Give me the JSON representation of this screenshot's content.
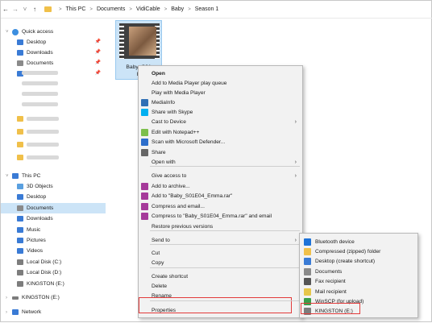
{
  "address_bar": {
    "back_icon": "back-arrow-icon",
    "forward_icon": "forward-arrow-icon",
    "dropdown_icon": "chevron-down-icon",
    "up_icon": "up-arrow-icon",
    "separator": ">",
    "crumbs": [
      "This PC",
      "Documents",
      "VidiCable",
      "Baby",
      "Season 1"
    ]
  },
  "nav": {
    "quick_access": "Quick access",
    "quick_items": [
      "Desktop",
      "Downloads",
      "Documents",
      "Pictures"
    ],
    "this_pc": "This PC",
    "pc_items": [
      "3D Objects",
      "Desktop",
      "Documents",
      "Downloads",
      "Music",
      "Pictures",
      "Videos",
      "Local Disk (C:)",
      "Local Disk (D:)",
      "KINGSTON (E:)"
    ],
    "kingston": "KINGSTON (E:)",
    "network": "Network"
  },
  "file": {
    "name_line1": "Baby_S01",
    "name_line2": "E"
  },
  "context_menu": {
    "items": [
      {
        "label": "Open",
        "bold": true
      },
      {
        "label": "Add to Media Player play queue"
      },
      {
        "label": "Play with Media Player"
      },
      {
        "label": "MediaInfo",
        "icon": "mediainfo-icon"
      },
      {
        "label": "Share with Skype",
        "icon": "skype-icon"
      },
      {
        "label": "Cast to Device",
        "arrow": true
      },
      {
        "label": "Edit with Notepad++",
        "icon": "notepad-icon"
      },
      {
        "label": "Scan with Microsoft Defender...",
        "icon": "defender-icon"
      },
      {
        "label": "Share",
        "icon": "share-icon"
      },
      {
        "label": "Open with",
        "arrow": true
      },
      {
        "label": "Give access to",
        "arrow": true
      },
      {
        "label": "Add to archive...",
        "icon": "winrar-icon"
      },
      {
        "label": "Add to \"Baby_S01E04_Emma.rar\"",
        "icon": "winrar-icon"
      },
      {
        "label": "Compress and email...",
        "icon": "winrar-icon"
      },
      {
        "label": "Compress to \"Baby_S01E04_Emma.rar\" and email",
        "icon": "winrar-icon"
      },
      {
        "label": "Restore previous versions"
      },
      {
        "label": "Send to",
        "arrow": true
      },
      {
        "label": "Cut"
      },
      {
        "label": "Copy"
      },
      {
        "label": "Create shortcut"
      },
      {
        "label": "Delete"
      },
      {
        "label": "Rename"
      },
      {
        "label": "Properties"
      }
    ]
  },
  "send_to_menu": {
    "items": [
      {
        "label": "Bluetooth device",
        "icon": "bluetooth-icon"
      },
      {
        "label": "Compressed (zipped) folder",
        "icon": "zip-folder-icon"
      },
      {
        "label": "Desktop (create shortcut)",
        "icon": "desktop-icon"
      },
      {
        "label": "Documents",
        "icon": "documents-icon"
      },
      {
        "label": "Fax recipient",
        "icon": "fax-icon"
      },
      {
        "label": "Mail recipient",
        "icon": "mail-icon"
      },
      {
        "label": "WinSCP (for upload)",
        "icon": "winscp-icon"
      },
      {
        "label": "KINGSTON (E:)",
        "icon": "usb-drive-icon"
      }
    ]
  },
  "colors": {
    "selection": "#cce4f7",
    "highlight_box": "#e23b3b",
    "menu_bg": "#f2f2f2"
  }
}
